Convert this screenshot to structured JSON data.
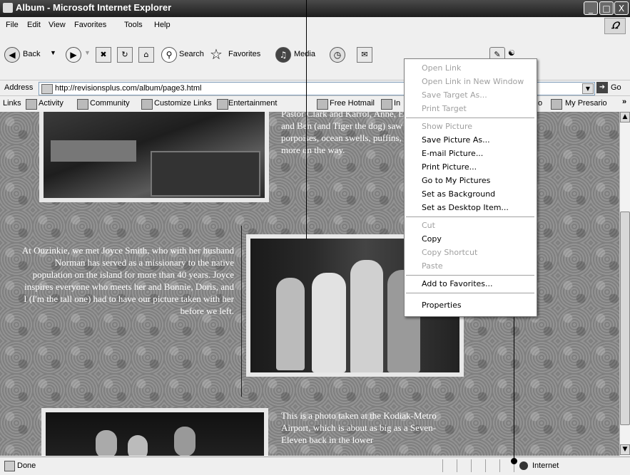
{
  "window": {
    "title": "Album - Microsoft Internet Explorer",
    "controls": [
      "_",
      "□",
      "X"
    ]
  },
  "menu": [
    "File",
    "Edit",
    "View",
    "Favorites",
    "Tools",
    "Help"
  ],
  "toolbar": {
    "back": "Back",
    "search": "Search",
    "favorites": "Favorites",
    "media": "Media"
  },
  "address": {
    "label": "Address",
    "url": "http://revisionsplus.com/album/page3.html",
    "go": "Go"
  },
  "links": {
    "label": "Links",
    "items": [
      "Activity",
      "Community",
      "Customize Links",
      "Entertainment",
      "Free Hotmail",
      "In",
      "o",
      "My Presario"
    ],
    "overflow": "»"
  },
  "content": {
    "story1": "Pastor Clark and Karrol, Anne, Evan Jr., and Ben (and Tiger the dog) saw porpoises, ocean swells, puffins, and more on the way.",
    "story2": "At Ouzinkie, we met Joyce Smith, who with her husband Norman has served as a missionary to the native population on the island for more than 40 years. Joyce inspires everyone who meets her and Bonnie, Doris, and I (I'm the tall one) had to have our picture taken with her before we left.",
    "story3": "This is a photo taken at the Kodiak-Metro Airport, which is about as big as a Seven-Eleven back in the lower"
  },
  "context_menu": {
    "items": [
      {
        "label": "Open Link",
        "enabled": false
      },
      {
        "label": "Open Link in New Window",
        "enabled": false
      },
      {
        "label": "Save Target As...",
        "enabled": false
      },
      {
        "label": "Print Target",
        "enabled": false
      },
      {
        "label": "Show Picture",
        "enabled": false
      },
      {
        "label": "Save Picture As...",
        "enabled": true
      },
      {
        "label": "E-mail Picture...",
        "enabled": true
      },
      {
        "label": "Print Picture...",
        "enabled": true
      },
      {
        "label": "Go to My Pictures",
        "enabled": true
      },
      {
        "label": "Set as Background",
        "enabled": true
      },
      {
        "label": "Set as Desktop Item...",
        "enabled": true
      },
      {
        "label": "Cut",
        "enabled": false
      },
      {
        "label": "Copy",
        "enabled": true
      },
      {
        "label": "Copy Shortcut",
        "enabled": false
      },
      {
        "label": "Paste",
        "enabled": false
      },
      {
        "label": "Add to Favorites...",
        "enabled": true
      },
      {
        "label": "Properties",
        "enabled": true
      }
    ]
  },
  "status": {
    "text": "Done",
    "zone": "Internet"
  }
}
